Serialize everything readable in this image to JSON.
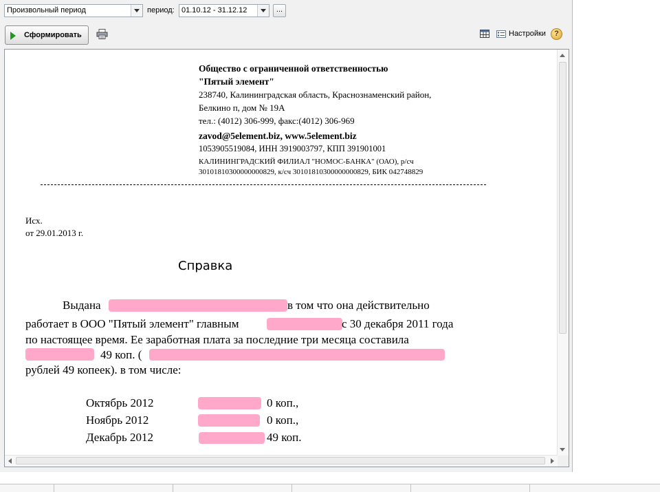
{
  "top_row": {
    "period_type": "Произвольный период",
    "period_label": "период:",
    "period_value": "01.10.12 - 31.12.12",
    "dots_button": "..."
  },
  "toolbar": {
    "generate_label": "Сформировать",
    "settings_label": "Настройки",
    "help_label": "?"
  },
  "letterhead": {
    "company_line1": "Общество с ограниченной ответственностью",
    "company_line2": "\"Пятый элемент\"",
    "address_line1": "238740, Калининградская область, Краснознаменский район,",
    "address_line2": "Белкино п, дом № 19А",
    "phones": "тел.: (4012) 306-999, факс:(4012) 306-969",
    "web": "zavod@5element.biz, www.5element.biz",
    "ids": "1053905519084, ИНН 3919003797, КПП 391901001",
    "bank_line1": "КАЛИНИНГРАДСКИЙ ФИЛИАЛ \"НОМОС-БАНКА\" (ОАО), р/сч",
    "bank_line2": "30101810300000000829, к/сч 30101810300000000829, БИК 042748829"
  },
  "outgoing": {
    "ref_label": "Исх.",
    "date_line": "от 29.01.2013 г."
  },
  "certificate": {
    "title": "Справка",
    "line1_start": "Выдана",
    "line1_end": "в том что она действительно",
    "line2_start": "работает в ООО \"Пятый элемент\" главным",
    "line2_end": "с 30 декабря 2011 года",
    "line3": "по настоящее время. Ее заработная плата за последние три месяца составила",
    "line4_mid": "49 коп. (",
    "line5": "рублей 49 копеек). в том числе:"
  },
  "salary_rows": [
    {
      "month": "Октябрь 2012",
      "kop": "0 коп.,"
    },
    {
      "month": "Ноябрь 2012",
      "kop": "0 коп.,"
    },
    {
      "month": "Декабрь 2012",
      "kop": "49 коп."
    }
  ],
  "colors": {
    "redaction": "#ff9fc3",
    "play_arrow": "#1f9a1f"
  }
}
